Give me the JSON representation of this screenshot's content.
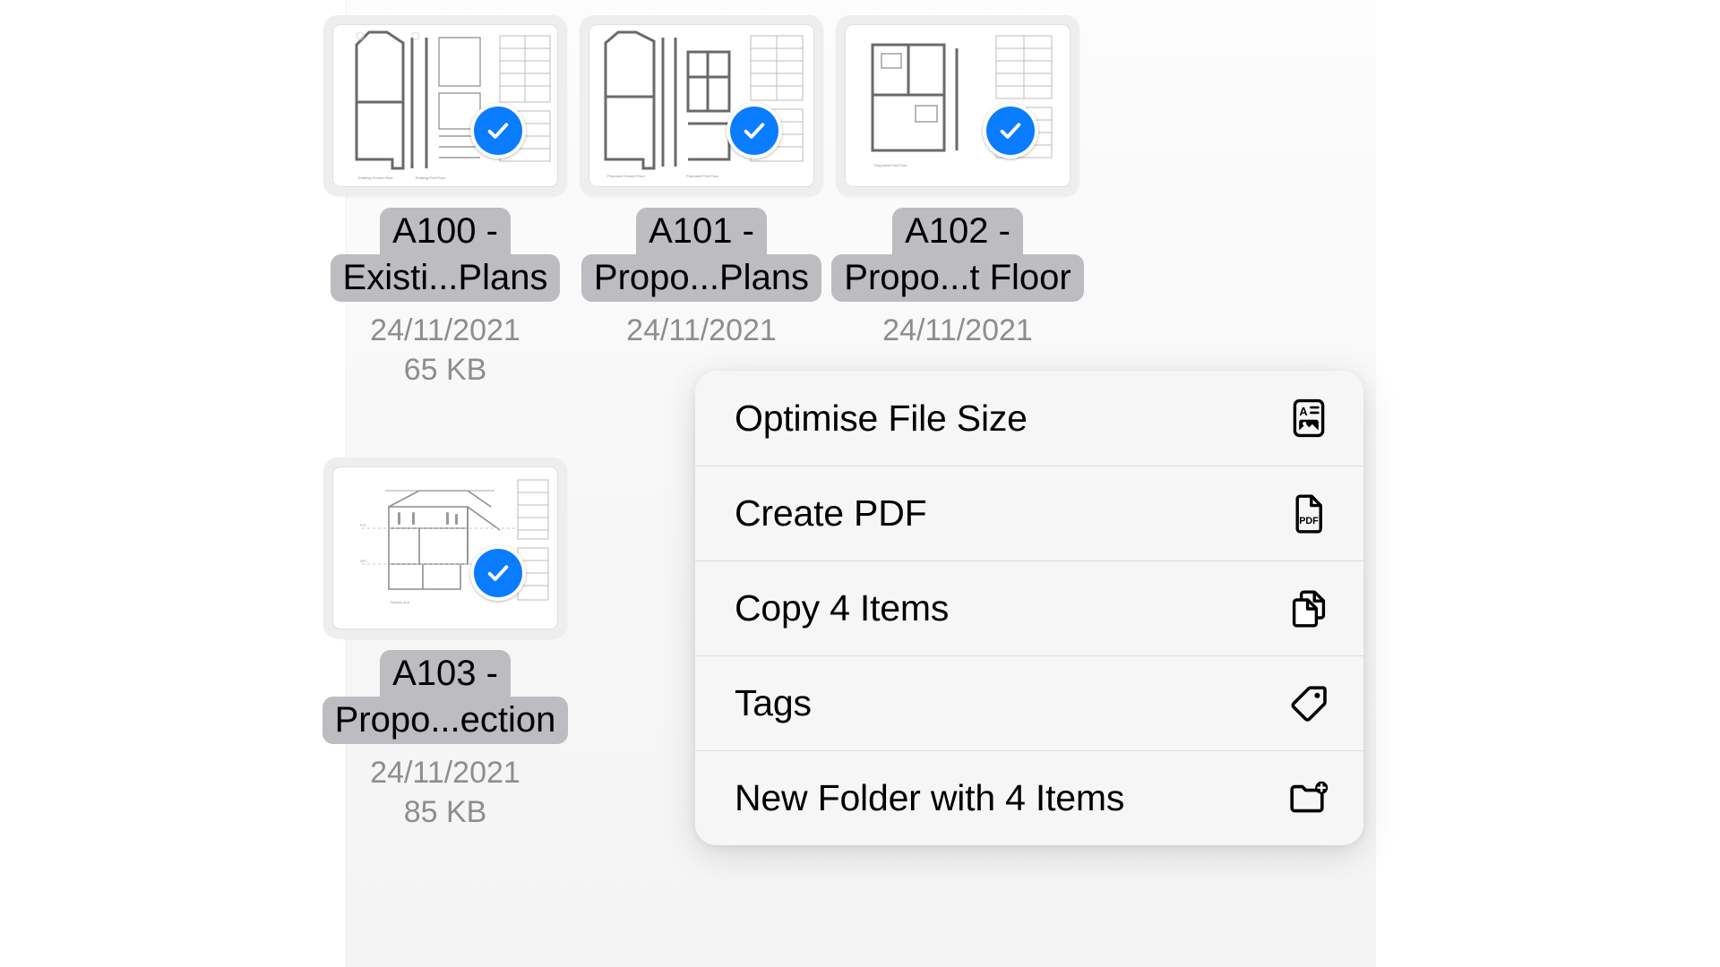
{
  "theme": {
    "accent_color": "#0a7cff",
    "label_highlight_color": "#bcbcc1",
    "menu_background": "#f6f6f6",
    "meta_text_color": "#8d8d92",
    "page_background": "#ffffff"
  },
  "files": [
    {
      "id": "a100",
      "name_line1": "A100 -",
      "name_line2": "Existi...Plans",
      "date": "24/11/2021",
      "size": "65 KB",
      "selected": true,
      "thumbnail": "floor-plan-existing",
      "badge_icon": "checkmark-circle-icon"
    },
    {
      "id": "a101",
      "name_line1": "A101 -",
      "name_line2": "Propo...Plans",
      "date": "24/11/2021",
      "size": "",
      "selected": true,
      "thumbnail": "floor-plan-proposed",
      "badge_icon": "checkmark-circle-icon"
    },
    {
      "id": "a102",
      "name_line1": "A102 -",
      "name_line2": "Propo...t Floor",
      "date": "24/11/2021",
      "size": "",
      "selected": true,
      "thumbnail": "floor-plan-first-floor",
      "badge_icon": "checkmark-circle-icon"
    },
    {
      "id": "a103",
      "name_line1": "A103 -",
      "name_line2": "Propo...ection",
      "date": "24/11/2021",
      "size": "85 KB",
      "selected": true,
      "thumbnail": "section-drawing",
      "badge_icon": "checkmark-circle-icon"
    }
  ],
  "context_menu": {
    "items": [
      {
        "label": "Optimise File Size",
        "icon": "document-with-photo-icon"
      },
      {
        "label": "Create PDF",
        "icon": "pdf-document-icon"
      },
      {
        "label": "Copy 4 Items",
        "icon": "copy-documents-icon"
      },
      {
        "label": "Tags",
        "icon": "tag-icon"
      },
      {
        "label": "New Folder with 4 Items",
        "icon": "new-folder-icon"
      }
    ]
  }
}
